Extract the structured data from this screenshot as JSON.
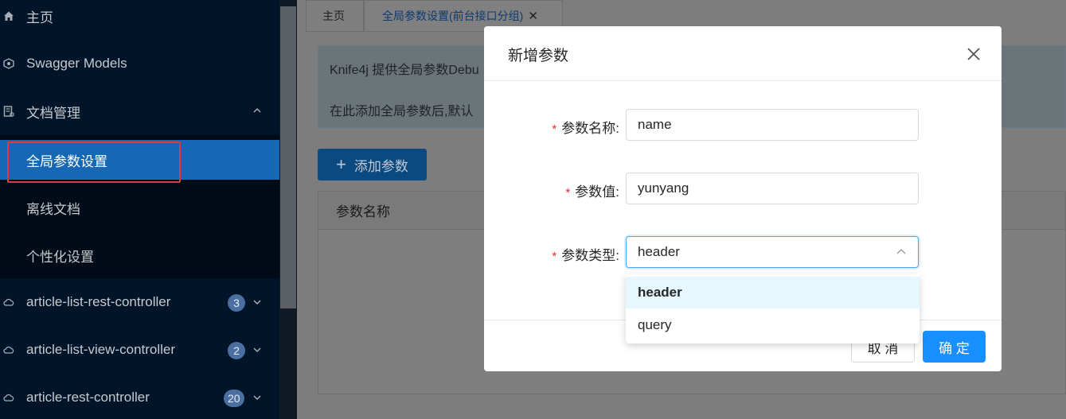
{
  "sidebar": {
    "items": [
      {
        "label": "主页",
        "icon": "home-icon"
      },
      {
        "label": "Swagger Models",
        "icon": "model-icon"
      },
      {
        "label": "文档管理",
        "icon": "doc-manage-icon"
      }
    ],
    "doc_children": [
      {
        "label": "全局参数设置"
      },
      {
        "label": "离线文档"
      },
      {
        "label": "个性化设置"
      }
    ],
    "controllers": [
      {
        "label": "article-list-rest-controller",
        "count": "3"
      },
      {
        "label": "article-list-view-controller",
        "count": "2"
      },
      {
        "label": "article-rest-controller",
        "count": "20"
      }
    ]
  },
  "tabs": [
    {
      "label": "主页"
    },
    {
      "label": "全局参数设置(前台接口分组)"
    }
  ],
  "alert": {
    "line1": "Knife4j 提供全局参数Debu",
    "line2": "在此添加全局参数后,默认"
  },
  "add_button": {
    "label": "添加参数"
  },
  "table": {
    "col_name": "参数名称"
  },
  "modal": {
    "title": "新增参数",
    "fields": {
      "name": {
        "label": "参数名称:",
        "value": "name"
      },
      "value": {
        "label": "参数值:",
        "value": "yunyang"
      },
      "type": {
        "label": "参数类型:",
        "value": "header"
      }
    },
    "cancel": "取 消",
    "ok": "确 定"
  },
  "dropdown": {
    "options": [
      "header",
      "query"
    ],
    "selected": "header"
  },
  "colors": {
    "accent": "#1890ff",
    "sidebar_bg": "#001529",
    "active_menu": "#1668b4",
    "required": "#f5222d"
  }
}
